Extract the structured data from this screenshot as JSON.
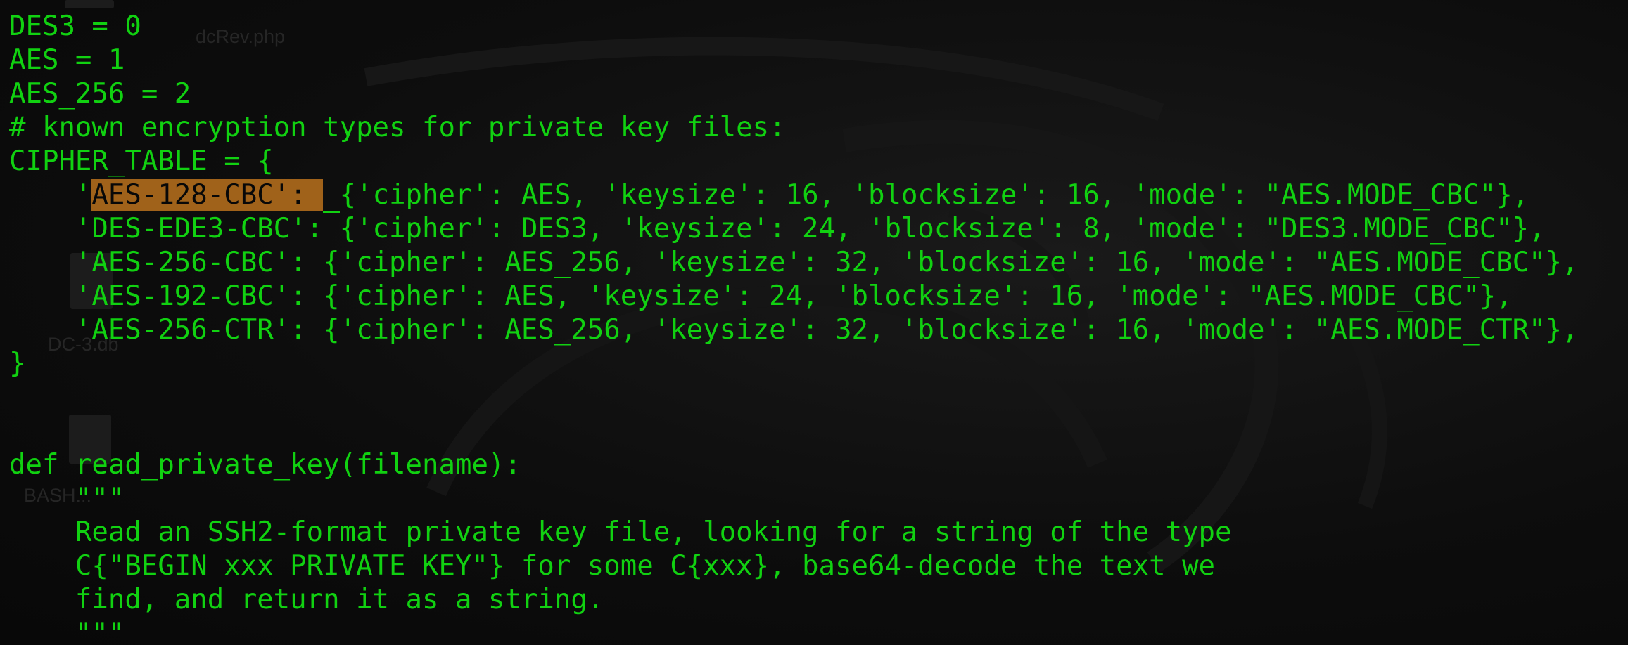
{
  "desktop": {
    "file_label_1": "dcRev.php",
    "file_label_2": "DC-3.db",
    "file_label_3": "BASH..."
  },
  "terminal": {
    "lines": [
      "DES3 = 0",
      "AES = 1",
      "AES_256 = 2",
      "# known encryption types for private key files:",
      "CIPHER_TABLE = {",
      null,
      "    'DES-EDE3-CBC': {'cipher': DES3, 'keysize': 24, 'blocksize': 8, 'mode': \"DES3.MODE_CBC\"},",
      "    'AES-256-CBC': {'cipher': AES_256, 'keysize': 32, 'blocksize': 16, 'mode': \"AES.MODE_CBC\"},",
      "    'AES-192-CBC': {'cipher': AES, 'keysize': 24, 'blocksize': 16, 'mode': \"AES.MODE_CBC\"},",
      "    'AES-256-CTR': {'cipher': AES_256, 'keysize': 32, 'blocksize': 16, 'mode': \"AES.MODE_CTR\"},",
      "}",
      "",
      "",
      "def read_private_key(filename):",
      "    \"\"\"",
      "    Read an SSH2-format private key file, looking for a string of the type",
      "    C{\"BEGIN xxx PRIVATE KEY\"} for some C{xxx}, base64-decode the text we",
      "    find, and return it as a string.",
      "    \"\"\""
    ],
    "highlight_line": {
      "prefix": "    '",
      "selected": "AES-128-CBC': ",
      "cursor_char": " ",
      "suffix": "{'cipher': AES, 'keysize': 16, 'blocksize': 16, 'mode': \"AES.MODE_CBC\"},"
    },
    "colors": {
      "text": "#11d111",
      "selection": "#a0621a",
      "background": "#0b0b0b"
    }
  }
}
